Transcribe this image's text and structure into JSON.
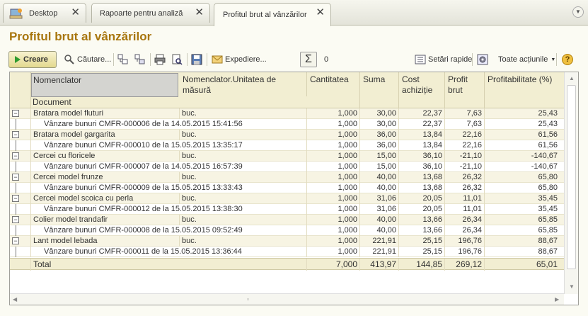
{
  "tabs": [
    {
      "label": "Desktop",
      "active": false
    },
    {
      "label": "Rapoarte pentru analiză",
      "active": false
    },
    {
      "label": "Profitul brut al vânzărilor",
      "active": true
    }
  ],
  "page_title": "Profitul brut al vânzărilor",
  "toolbar": {
    "create_label": "Creare",
    "search_label": "Căutare...",
    "send_label": "Expediere...",
    "sigma_value": "0",
    "quick_settings_label": "Setări rapide",
    "all_actions_label": "Toate acțiunile",
    "help_label": "?"
  },
  "table": {
    "columns": [
      "Nomenclator",
      "Nomenclator.Unitatea de măsură",
      "Cantitatea",
      "Suma",
      "Cost achiziție",
      "Profit brut",
      "Profitabilitate (%)"
    ],
    "subheader": "Document",
    "rows": [
      {
        "type": "parent",
        "name": "Bratara model fluturi",
        "unit": "buc.",
        "qty": "1,000",
        "sum": "30,00",
        "cost": "22,37",
        "profit": "7,63",
        "pct": "25,43"
      },
      {
        "type": "child",
        "name": "Vânzare bunuri CMFR-000006 de la 14.05.2015 15:41:56",
        "unit": "",
        "qty": "1,000",
        "sum": "30,00",
        "cost": "22,37",
        "profit": "7,63",
        "pct": "25,43"
      },
      {
        "type": "parent",
        "name": "Bratara model gargarita",
        "unit": "buc.",
        "qty": "1,000",
        "sum": "36,00",
        "cost": "13,84",
        "profit": "22,16",
        "pct": "61,56"
      },
      {
        "type": "child",
        "name": "Vânzare bunuri CMFR-000010 de la 15.05.2015 13:35:17",
        "unit": "",
        "qty": "1,000",
        "sum": "36,00",
        "cost": "13,84",
        "profit": "22,16",
        "pct": "61,56"
      },
      {
        "type": "parent",
        "name": "Cercei cu floricele",
        "unit": "buc.",
        "qty": "1,000",
        "sum": "15,00",
        "cost": "36,10",
        "profit": "-21,10",
        "pct": "-140,67"
      },
      {
        "type": "child",
        "name": "Vânzare bunuri CMFR-000007 de la 14.05.2015 16:57:39",
        "unit": "",
        "qty": "1,000",
        "sum": "15,00",
        "cost": "36,10",
        "profit": "-21,10",
        "pct": "-140,67"
      },
      {
        "type": "parent",
        "name": "Cercei model frunze",
        "unit": "buc.",
        "qty": "1,000",
        "sum": "40,00",
        "cost": "13,68",
        "profit": "26,32",
        "pct": "65,80"
      },
      {
        "type": "child",
        "name": "Vânzare bunuri CMFR-000009 de la 15.05.2015 13:33:43",
        "unit": "",
        "qty": "1,000",
        "sum": "40,00",
        "cost": "13,68",
        "profit": "26,32",
        "pct": "65,80"
      },
      {
        "type": "parent",
        "name": "Cercei model scoica cu perla",
        "unit": "buc.",
        "qty": "1,000",
        "sum": "31,06",
        "cost": "20,05",
        "profit": "11,01",
        "pct": "35,45"
      },
      {
        "type": "child",
        "name": "Vânzare bunuri CMFR-000012 de la 15.05.2015 13:38:30",
        "unit": "",
        "qty": "1,000",
        "sum": "31,06",
        "cost": "20,05",
        "profit": "11,01",
        "pct": "35,45"
      },
      {
        "type": "parent",
        "name": "Colier model trandafir",
        "unit": "buc.",
        "qty": "1,000",
        "sum": "40,00",
        "cost": "13,66",
        "profit": "26,34",
        "pct": "65,85"
      },
      {
        "type": "child",
        "name": "Vânzare bunuri CMFR-000008 de la 15.05.2015 09:52:49",
        "unit": "",
        "qty": "1,000",
        "sum": "40,00",
        "cost": "13,66",
        "profit": "26,34",
        "pct": "65,85"
      },
      {
        "type": "parent",
        "name": "Lant model lebada",
        "unit": "buc.",
        "qty": "1,000",
        "sum": "221,91",
        "cost": "25,15",
        "profit": "196,76",
        "pct": "88,67"
      },
      {
        "type": "child",
        "name": "Vânzare bunuri CMFR-000011 de la 15.05.2015 13:36:44",
        "unit": "",
        "qty": "1,000",
        "sum": "221,91",
        "cost": "25,15",
        "profit": "196,76",
        "pct": "88,67"
      }
    ],
    "total": {
      "label": "Total",
      "qty": "7,000",
      "sum": "413,97",
      "cost": "144,85",
      "profit": "269,12",
      "pct": "65,01"
    }
  },
  "colors": {
    "title": "#a8760e",
    "create_button": "#e3d98f",
    "header_bg": "#f2eed2"
  }
}
